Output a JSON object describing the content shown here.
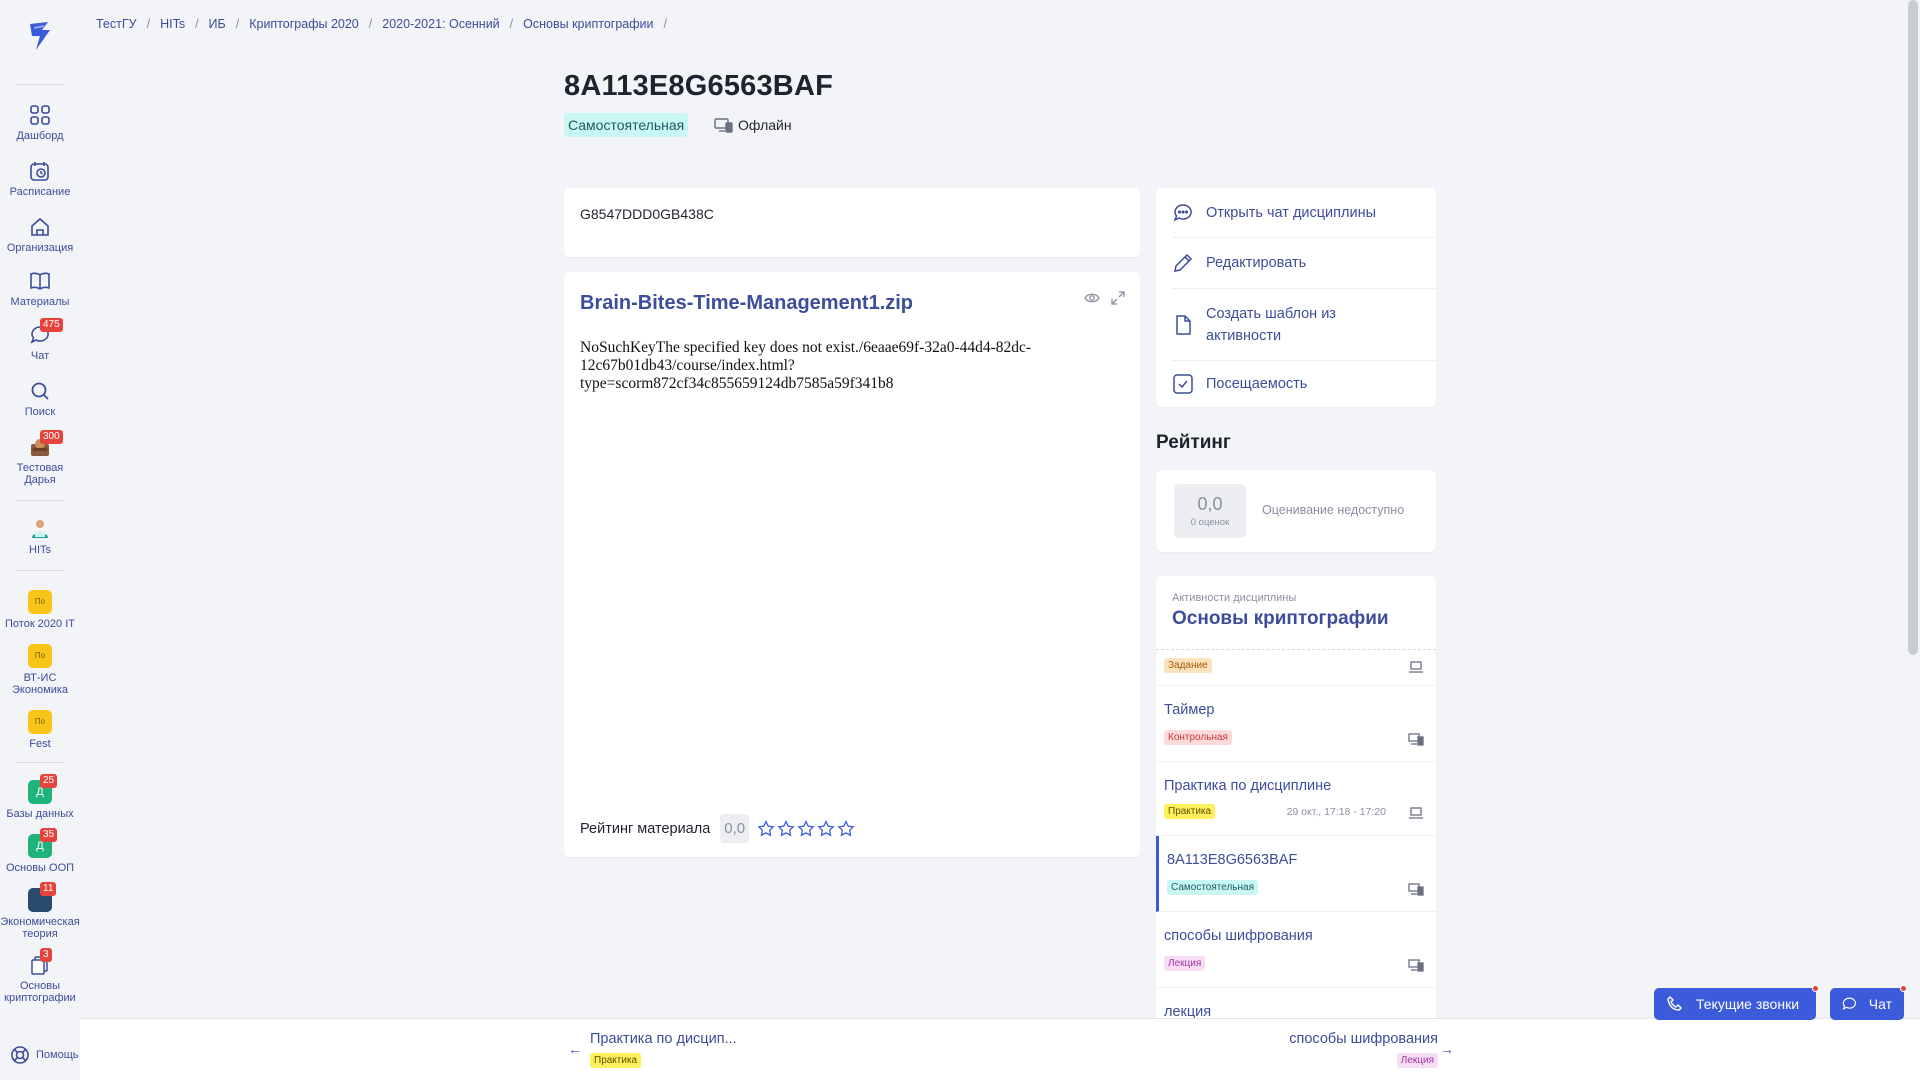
{
  "breadcrumbs": [
    "ТестГУ",
    "HITs",
    "ИБ",
    "Криптографы 2020",
    "2020-2021: Осенний",
    "Основы криптографии"
  ],
  "sidebar": {
    "main": [
      {
        "label": "Дашборд",
        "icon": "dashboard-icon"
      },
      {
        "label": "Расписание",
        "icon": "schedule-icon"
      },
      {
        "label": "Организация",
        "icon": "organization-icon"
      },
      {
        "label": "Материалы",
        "icon": "materials-icon"
      },
      {
        "label": "Чат",
        "icon": "chat-icon",
        "badge": "475"
      },
      {
        "label": "Поиск",
        "icon": "search-icon"
      },
      {
        "label": "Тестовая Дарья",
        "icon": "avatar-icon",
        "badge": "300"
      }
    ],
    "hits_label": "HITs",
    "streams": [
      {
        "label": "Поток 2020 IT",
        "tile": "По"
      },
      {
        "label": "ВТ-ИС Экономика",
        "tile": "По"
      },
      {
        "label": "Fest",
        "tile": "По"
      }
    ],
    "courses": [
      {
        "label": "Базы данных",
        "tile": "Д",
        "badge": "25"
      },
      {
        "label": "Основы ООП",
        "tile": "Д",
        "badge": "35"
      },
      {
        "label": "Экономическая теория",
        "badge": "11"
      },
      {
        "label": "Основы криптографии",
        "badge": "3"
      }
    ],
    "help_label": "Помощь"
  },
  "page": {
    "title": "8A113E8G6563BAF",
    "type_chip": "Самостоятельная",
    "mode": "Офлайн",
    "code": "G8547DDD0GB438C"
  },
  "file": {
    "name": "Brain-Bites-Time-Management1.zip",
    "error_text": "NoSuchKeyThe specified key does not exist./6eaae69f-32a0-44d4-82dc-12c67b01db43/course/index.html?type=scorm872cf34c855659124db7585a59f341b8",
    "rating_label": "Рейтинг материала",
    "rating_value": "0,0",
    "stars_filled": 0,
    "stars_total": 5
  },
  "actions": [
    {
      "label": "Открыть чат дисциплины",
      "icon": "chat-bubble-icon"
    },
    {
      "label": "Редактировать",
      "icon": "pencil-icon"
    },
    {
      "label": "Создать шаблон из активности",
      "icon": "document-icon"
    },
    {
      "label": "Посещаемость",
      "icon": "checkbox-icon"
    }
  ],
  "rating": {
    "title": "Рейтинг",
    "score": "0,0",
    "count_label": "0 оценок",
    "note": "Оценивание недоступно"
  },
  "activities": {
    "caption": "Активности дисциплины",
    "course": "Основы криптографии",
    "items": [
      {
        "title": "",
        "tag": "Задание",
        "tag_color": "orange",
        "meta": ""
      },
      {
        "title": "Таймер",
        "tag": "Контрольная",
        "tag_color": "red",
        "meta": ""
      },
      {
        "title": "Практика по дисциплине",
        "tag": "Практика",
        "tag_color": "yellow",
        "meta": "29 окт., 17:18 - 17:20"
      },
      {
        "title": "8A113E8G6563BAF",
        "tag": "Самостоятельная",
        "tag_color": "cyan",
        "meta": "",
        "active": true
      },
      {
        "title": "способы шифрования",
        "tag": "Лекция",
        "tag_color": "pink",
        "meta": ""
      },
      {
        "title": "лекция",
        "tag": "",
        "tag_color": "",
        "meta": ""
      }
    ]
  },
  "nav": {
    "prev_title": "Практика по дисцип...",
    "prev_tag": "Практика",
    "next_title": "способы шифрования",
    "next_tag": "Лекция"
  },
  "floating": {
    "calls_label": "Текущие звонки",
    "chat_label": "Чат"
  },
  "colors": {
    "accent": "#3b5bdb",
    "link": "#3d4d9a",
    "badge": "#e5433b"
  }
}
